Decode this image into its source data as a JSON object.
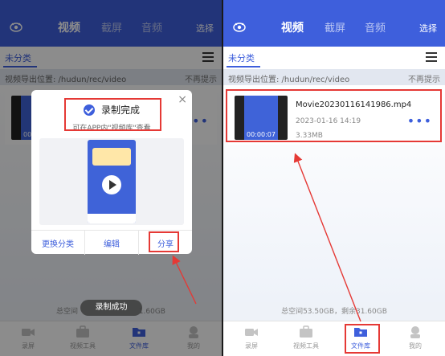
{
  "header": {
    "tabs": [
      "视频",
      "截屏",
      "音频"
    ],
    "select": "选择"
  },
  "category": {
    "label": "未分类"
  },
  "path": {
    "text": "视频导出位置: /hudun/rec/video",
    "dismiss": "不再提示"
  },
  "file": {
    "name": "Movie20230116141986.mp4",
    "date": "2023-01-16   14:19",
    "size": "3.33MB",
    "duration": "00:00:07"
  },
  "storage": {
    "left_text": "总空间",
    "left_tail": "1.60GB",
    "right_text": "总空间53.50GB，剩余31.60GB"
  },
  "nav": [
    "录屏",
    "视频工具",
    "文件库",
    "我的"
  ],
  "dialog": {
    "title": "录制完成",
    "subtitle": "可在APP内\"视频库\"查看",
    "buttons": [
      "更换分类",
      "编辑",
      "分享"
    ],
    "close": "×"
  },
  "toast": "录制成功",
  "colors": {
    "primary": "#3e5fdc",
    "highlight": "#e53935"
  },
  "icons": {
    "logo": "eye-logo-icon",
    "menu": "hamburger-icon",
    "more": "more-dots-icon",
    "check": "check-circle-icon",
    "close": "close-icon"
  }
}
